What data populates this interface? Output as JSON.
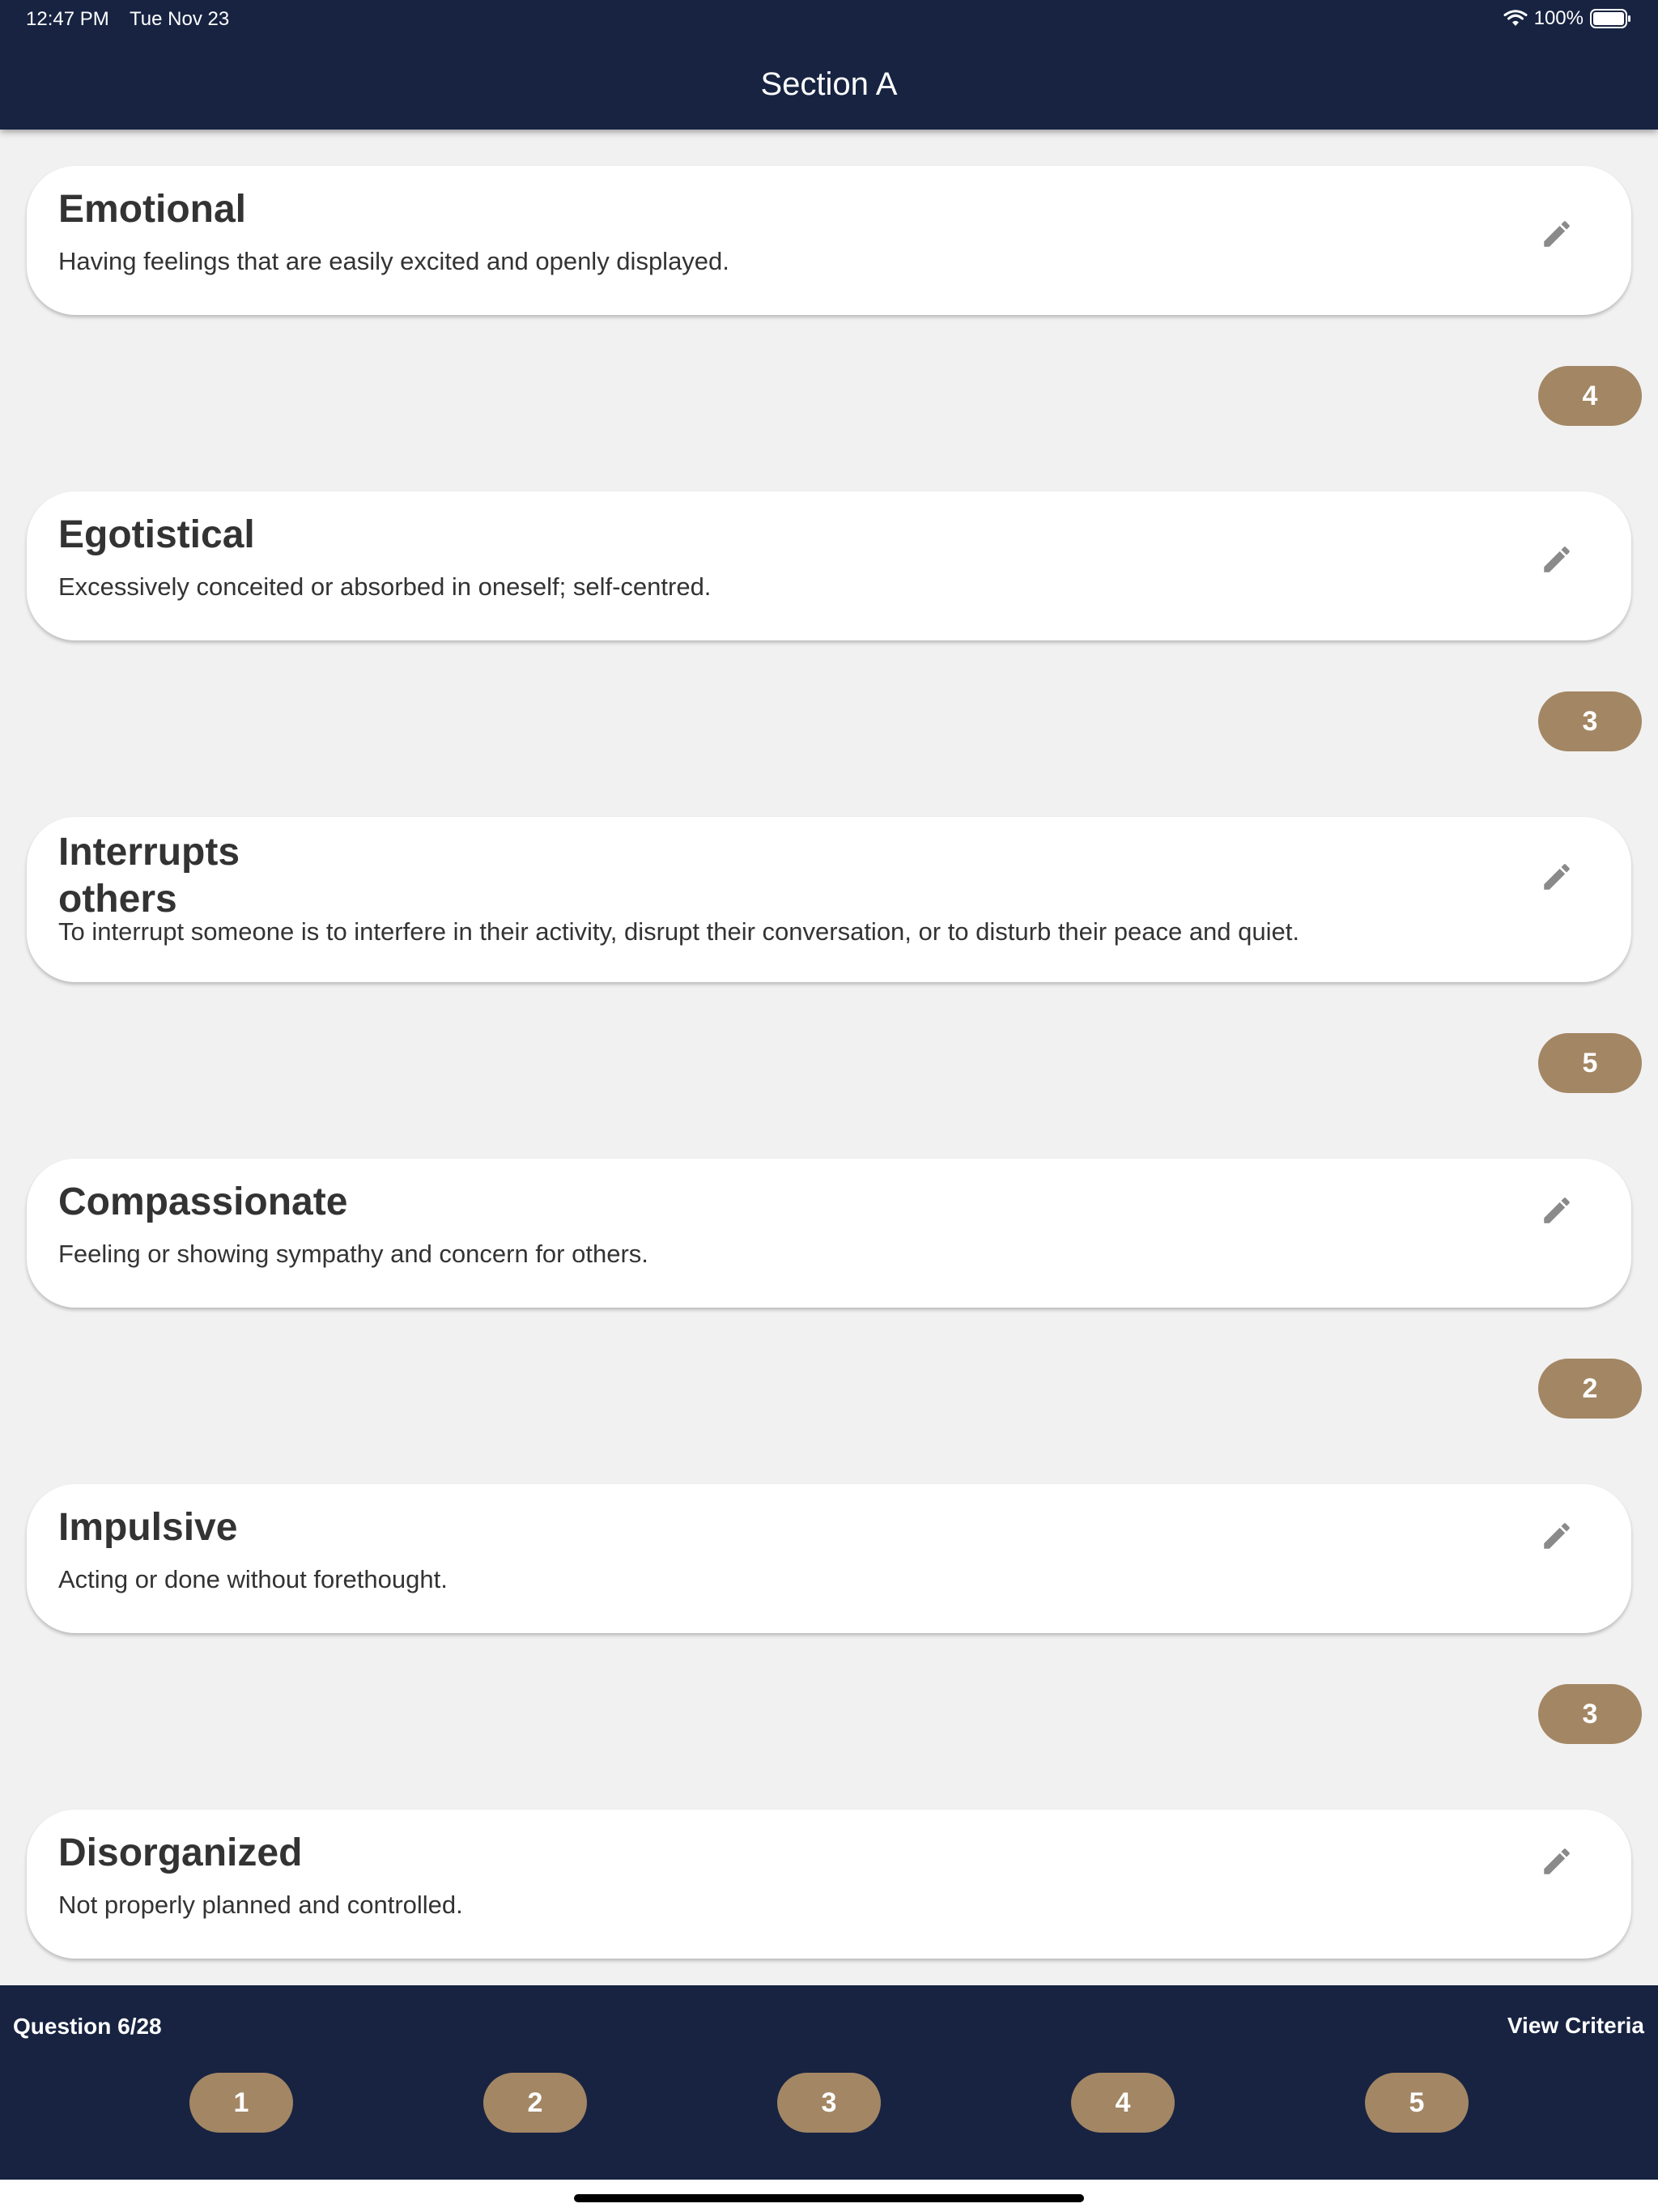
{
  "status_bar": {
    "time": "12:47 PM",
    "date": "Tue Nov 23",
    "battery": "100%"
  },
  "header": {
    "title": "Section A"
  },
  "items": [
    {
      "title": "Emotional",
      "description": "Having feelings that are easily excited and openly displayed.",
      "rating": "4"
    },
    {
      "title": "Egotistical",
      "description": "Excessively conceited or absorbed in oneself; self-centred.",
      "rating": "3"
    },
    {
      "title_lines": [
        "Interrupts",
        "others"
      ],
      "description": "To interrupt someone is to interfere in their activity, disrupt their conversation, or to disturb their peace and quiet.",
      "rating": "5"
    },
    {
      "title": "Compassionate",
      "description": "Feeling or showing sympathy and concern for others.",
      "rating": "2"
    },
    {
      "title": "Impulsive",
      "description": "Acting or done without forethought.",
      "rating": "3"
    },
    {
      "title": "Disorganized",
      "description": "Not properly planned and controlled."
    }
  ],
  "footer": {
    "question_counter": "Question 6/28",
    "view_criteria": "View Criteria",
    "options": [
      "1",
      "2",
      "3",
      "4",
      "5"
    ]
  },
  "colors": {
    "header_bg": "#172341",
    "accent": "#a38664",
    "page_bg": "#f1f1f1",
    "card_bg": "#ffffff",
    "text": "#333333"
  },
  "icons": {
    "edit": "pencil-icon",
    "wifi": "wifi-icon",
    "battery": "battery-icon"
  }
}
